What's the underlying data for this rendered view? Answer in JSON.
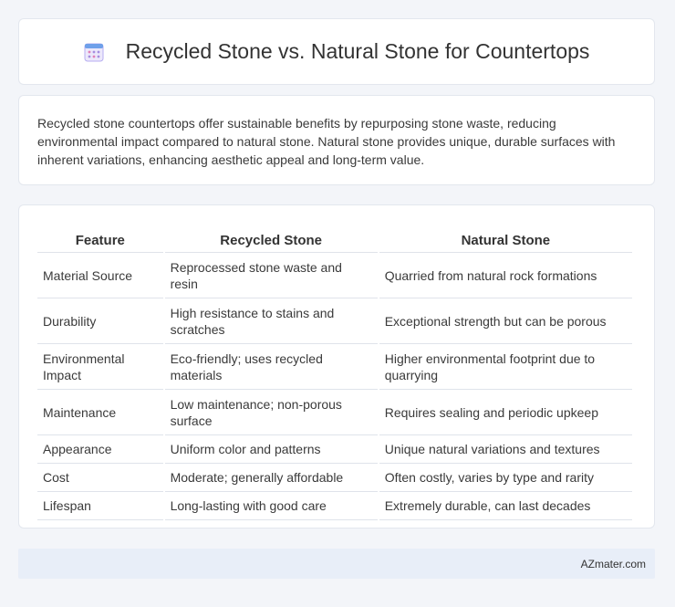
{
  "header": {
    "title": "Recycled Stone vs. Natural Stone for Countertops",
    "icon": "calendar-icon",
    "icon_color": "#8a7fd6"
  },
  "summary": "Recycled stone countertops offer sustainable benefits by repurposing stone waste, reducing environmental impact compared to natural stone. Natural stone provides unique, durable surfaces with inherent variations, enhancing aesthetic appeal and long-term value.",
  "table": {
    "headers": [
      "Feature",
      "Recycled Stone",
      "Natural Stone"
    ],
    "rows": [
      [
        "Material Source",
        "Reprocessed stone waste and resin",
        "Quarried from natural rock formations"
      ],
      [
        "Durability",
        "High resistance to stains and scratches",
        "Exceptional strength but can be porous"
      ],
      [
        "Environmental Impact",
        "Eco-friendly; uses recycled materials",
        "Higher environmental footprint due to quarrying"
      ],
      [
        "Maintenance",
        "Low maintenance; non-porous surface",
        "Requires sealing and periodic upkeep"
      ],
      [
        "Appearance",
        "Uniform color and patterns",
        "Unique natural variations and textures"
      ],
      [
        "Cost",
        "Moderate; generally affordable",
        "Often costly, varies by type and rarity"
      ],
      [
        "Lifespan",
        "Long-lasting with good care",
        "Extremely durable, can last decades"
      ]
    ]
  },
  "footer": {
    "credit": "AZmater.com"
  }
}
